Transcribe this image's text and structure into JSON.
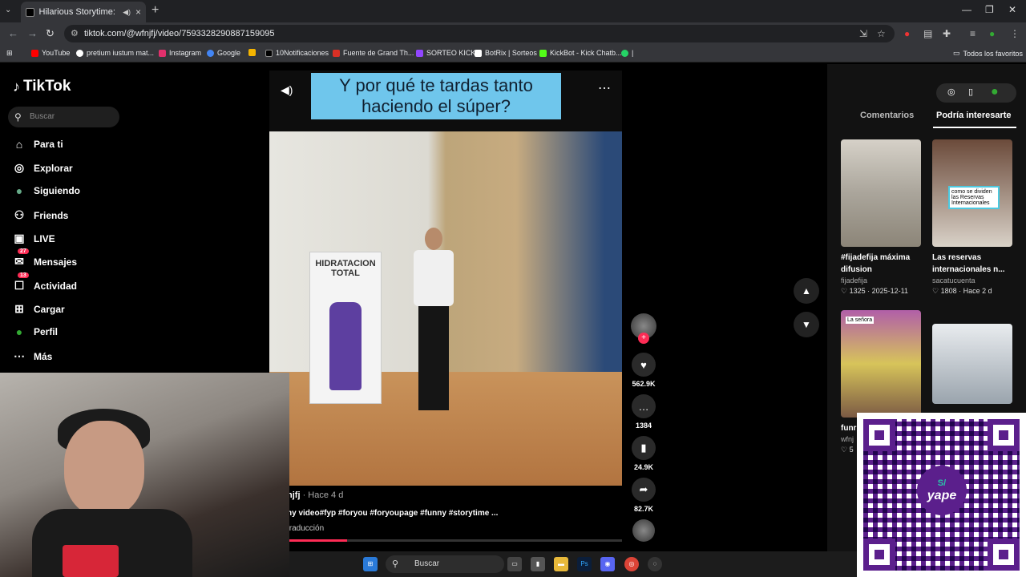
{
  "browser": {
    "tab_title": "Hilarious Storytime: Funny V",
    "url": "tiktok.com/@wfnjfj/video/7593328290887159095",
    "bookmarks": [
      {
        "label": "YouTube",
        "color": "#ff0000"
      },
      {
        "label": "pretium iustum mat...",
        "color": "#ffffff"
      },
      {
        "label": "Instagram",
        "color": "#e1306c"
      },
      {
        "label": "Google",
        "color": "#4285f4"
      },
      {
        "label": "",
        "color": "#f4b400"
      },
      {
        "label": "10Notificaciones",
        "color": "#000000"
      },
      {
        "label": "Fuente de Grand Th...",
        "color": "#d93025"
      },
      {
        "label": "SORTEO KICK",
        "color": "#9146ff"
      },
      {
        "label": "BotRix | Sorteos",
        "color": "#ffffff"
      },
      {
        "label": "KickBot - Kick Chatb...",
        "color": "#53fc18"
      },
      {
        "label": "|",
        "color": "#25d366"
      }
    ],
    "all_favorites": "Todos los favoritos"
  },
  "tiktok": {
    "logo": "TikTok",
    "search_placeholder": "Buscar",
    "nav": [
      {
        "label": "Para ti",
        "icon": "home-icon",
        "glyph": "⌂"
      },
      {
        "label": "Explorar",
        "icon": "compass-icon",
        "glyph": "◎"
      },
      {
        "label": "Siguiendo",
        "icon": "following-avatar-icon",
        "glyph": "●"
      },
      {
        "label": "Friends",
        "icon": "friends-icon",
        "glyph": "⚇"
      },
      {
        "label": "LIVE",
        "icon": "live-icon",
        "glyph": "▣"
      },
      {
        "label": "Mensajes",
        "icon": "messages-icon",
        "glyph": "✉",
        "badge": "27"
      },
      {
        "label": "Actividad",
        "icon": "activity-icon",
        "glyph": "☐",
        "badge": "13"
      },
      {
        "label": "Cargar",
        "icon": "upload-icon",
        "glyph": "⊞"
      },
      {
        "label": "Perfil",
        "icon": "profile-avatar-icon",
        "glyph": "●"
      },
      {
        "label": "Más",
        "icon": "more-icon",
        "glyph": "⋯"
      }
    ]
  },
  "video": {
    "caption": "Y por qué te tardas tanto haciendo el súper?",
    "standee_text": "HIDRATACION TOTAL",
    "author": "njfj",
    "time_ago": "· Hace 4 d",
    "description": "ny video#fyp #foryou #foryoupage #funny #storytime ...",
    "translation": "traducción",
    "progress_fraction": 0.22
  },
  "actions": {
    "likes": "562.9K",
    "comments": "1384",
    "saves": "24.9K",
    "shares": "82.7K"
  },
  "panel": {
    "tab_comments": "Comentarios",
    "tab_interest": "Podría interesarte",
    "cards": [
      {
        "title": "#fijadefija máxima difusion",
        "author": "fijadefija",
        "stats": "♡ 1325 · 2025-12-11"
      },
      {
        "title": "Las reservas internacionales n...",
        "author": "sacatucuenta",
        "stats": "♡ 1808 · Hace 2 d",
        "thumb_text": "como se dividen las Reservas Internacionales"
      },
      {
        "title": "funr #for",
        "author": "wfnj",
        "stats": "♡ 5",
        "thumb_text": "La señora"
      },
      {
        "title": "",
        "author": "",
        "stats": ""
      }
    ]
  },
  "taskbar": {
    "search": "Buscar"
  },
  "qr": {
    "currency": "S/",
    "brand": "yape"
  }
}
